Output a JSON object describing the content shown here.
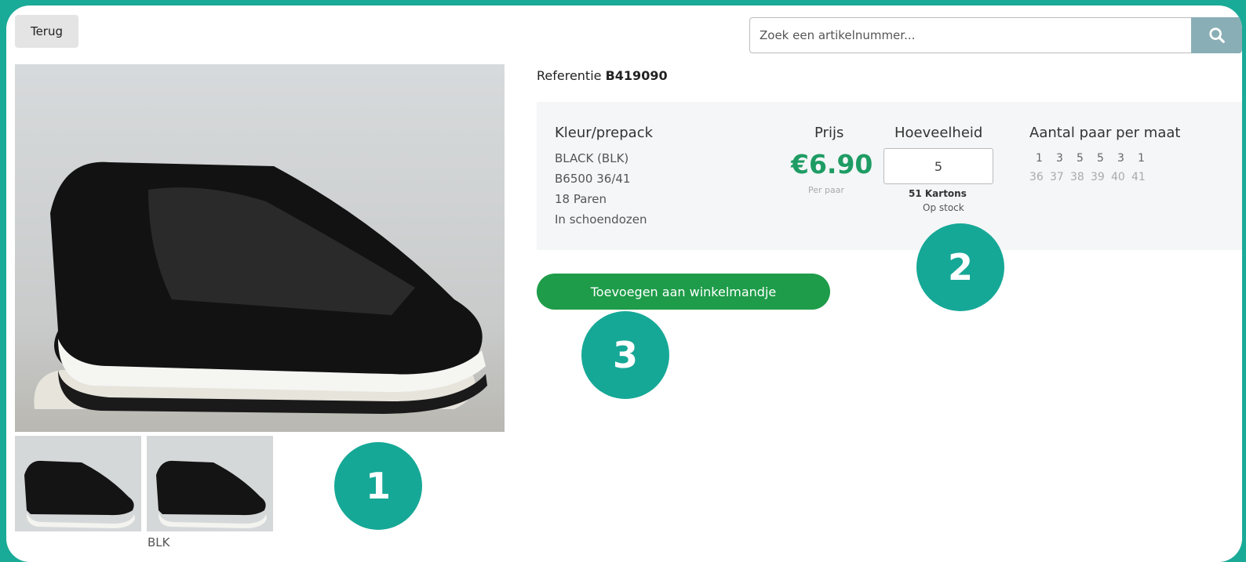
{
  "nav": {
    "back_label": "Terug"
  },
  "search": {
    "placeholder": "Zoek een artikelnummer...",
    "icon": "search-icon"
  },
  "product": {
    "ref_label": "Referentie",
    "ref_value": "B419090",
    "thumb_label": "BLK",
    "headers": {
      "color": "Kleur/prepack",
      "price": "Prijs",
      "quantity": "Hoeveelheid",
      "sizes": "Aantal paar per maat"
    },
    "color_lines": [
      "BLACK (BLK)",
      "B6500 36/41",
      "18 Paren",
      "In schoendozen"
    ],
    "price": "€6.90",
    "price_unit": "Per paar",
    "quantity_value": "5",
    "stock_count": "51 Kartons",
    "stock_status": "Op stock",
    "size_counts": [
      "1",
      "3",
      "5",
      "5",
      "3",
      "1"
    ],
    "size_values": [
      "36",
      "37",
      "38",
      "39",
      "40",
      "41"
    ]
  },
  "actions": {
    "add_to_cart": "Toevoegen aan winkelmandje"
  },
  "badges": [
    "1",
    "2",
    "3"
  ],
  "colors": {
    "accent": "#1aaa98",
    "green": "#1e9c49",
    "price": "#1e9c64"
  }
}
